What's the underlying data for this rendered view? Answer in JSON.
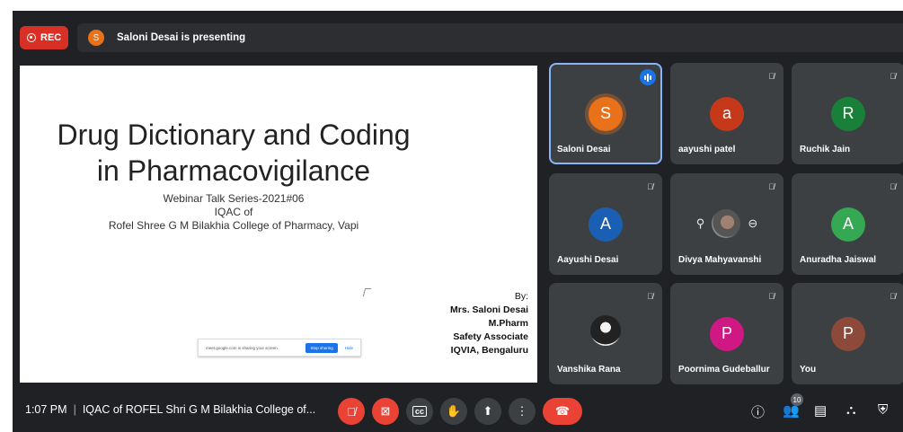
{
  "recording": {
    "label": "REC"
  },
  "presenter": {
    "avatar_letter": "S",
    "banner": "Saloni Desai is presenting",
    "avatar_color": "#e8711a"
  },
  "slide": {
    "title_line1": "Drug Dictionary and Coding",
    "title_line2": "in Pharmacovigilance",
    "sub_line1": "Webinar Talk Series-2021#06",
    "sub_line2": "IQAC of",
    "sub_line3": "Rofel Shree G M Bilakhia College of Pharmacy, Vapi",
    "by_label": "By:",
    "by_name": "Mrs. Saloni Desai",
    "by_degree": "M.Pharm",
    "by_role": "Safety Associate",
    "by_company": "IQVIA, Bengaluru",
    "share_message": "meet.google.com is sharing your screen.",
    "share_stop": "Stop sharing",
    "share_hide": "Hide"
  },
  "participants": [
    {
      "name": "Saloni Desai",
      "letter": "S",
      "color": "#e8711a",
      "speaking": true
    },
    {
      "name": "aayushi patel",
      "letter": "a",
      "color": "#c5391a",
      "muted": true
    },
    {
      "name": "Ruchik Jain",
      "letter": "R",
      "color": "#188038",
      "muted": true
    },
    {
      "name": "Aayushi Desai",
      "letter": "A",
      "color": "#1a5fb4",
      "muted": true
    },
    {
      "name": "Divya Mahyavanshi",
      "letter": "",
      "muted": true,
      "pinned_view": true
    },
    {
      "name": "Anuradha Jaiswal",
      "letter": "A",
      "color": "#34a853",
      "muted": true
    },
    {
      "name": "Vanshika Rana",
      "letter": "",
      "muted": true,
      "photo": true
    },
    {
      "name": "Poornima Gudeballur",
      "letter": "P",
      "color": "#d01884",
      "muted": true
    },
    {
      "name": "You",
      "letter": "P",
      "color": "#8d4a3a",
      "muted": true
    }
  ],
  "bottom_bar": {
    "time": "1:07 PM",
    "meeting_title": "IQAC of ROFEL Shri G M Bilakhia College of...",
    "participant_count": "10"
  },
  "icons": {
    "mic_off": "mic-off-icon",
    "camera_off": "camera-off-icon",
    "captions": "captions-icon",
    "raise_hand": "raise-hand-icon",
    "present": "present-icon",
    "more": "more-options-icon",
    "end_call": "end-call-icon",
    "info": "info-icon",
    "people": "people-icon",
    "chat": "chat-icon",
    "activities": "activities-icon",
    "host": "host-controls-icon"
  }
}
